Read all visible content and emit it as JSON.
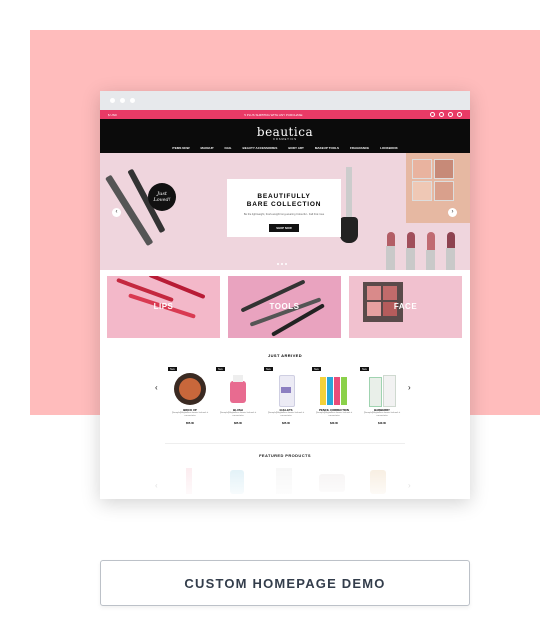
{
  "store": {
    "topbar_text": "5 PLUS SHIPPING WITH ANY PURCHASE",
    "logo": "beautica",
    "logo_sub": "COSMETICS",
    "nav": [
      "ITEMS NOW",
      "MAKEUP",
      "NAIL",
      "BEAUTY ACCESSORIES",
      "BODY ART",
      "MAKEUP TOOLS",
      "FRAGRANCE",
      "LOOKBOOK"
    ],
    "hero": {
      "bubble": "Just Loved!",
      "title_line1": "BEAUTIFULLY",
      "title_line2": "BARE COLLECTION",
      "desc": "Be the lightweight, fresh-weight long-wearing Colourful - Fall Frat rose",
      "button": "SHOP NOW"
    },
    "categories": [
      {
        "label": "LIPS",
        "color": "#f3b8c9"
      },
      {
        "label": "TOOLS",
        "color": "#e9a3bf"
      },
      {
        "label": "FACE",
        "color": "#f1c1cf"
      }
    ],
    "just_arrived_title": "JUST ARRIVED",
    "products": [
      {
        "badge": "New",
        "name": "BRICK UP",
        "desc": "[Sample]Maybelline dermis lasheek it consectetur",
        "price": "$55.00"
      },
      {
        "badge": "New",
        "name": "BLUSH",
        "desc": "[Sample]Maybelline dermis lasheek it consectetur",
        "price": "$65.00"
      },
      {
        "badge": "New",
        "name": "GULLETS",
        "desc": "[Sample]Maybelline dermis lasheek it consectetur",
        "price": "$25.00"
      },
      {
        "badge": "New",
        "name": "PENCIL CORRECTION",
        "desc": "[Sample]Maybelline dermis lasheek it consectetur",
        "price": "$30.00"
      },
      {
        "badge": "New",
        "name": "BARBERRY",
        "desc": "[Sample]Maybelline dermis lasheek it consectetur",
        "price": "$40.00"
      }
    ],
    "featured_title": "FEATURED PRODUCTS"
  },
  "cta": {
    "label": "CUSTOM HOMEPAGE DEMO"
  }
}
